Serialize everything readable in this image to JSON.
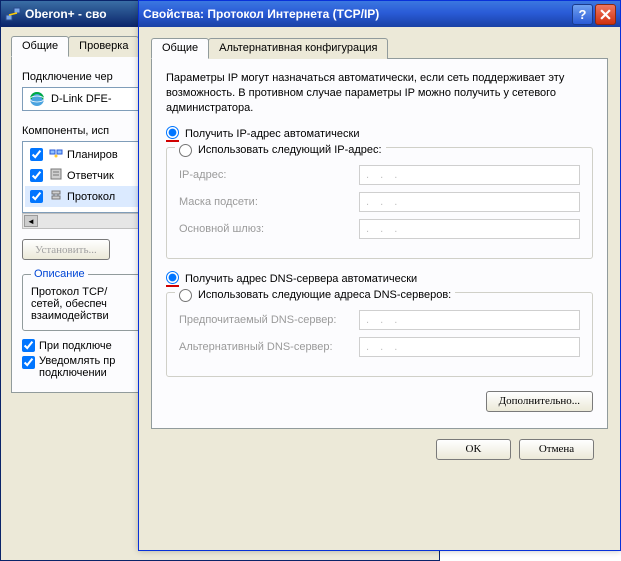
{
  "back": {
    "title": "Oberon+ - сво",
    "tabs": [
      "Общие",
      "Проверка"
    ],
    "connect_via_label": "Подключение чер",
    "adapter": "D-Link DFE-",
    "components_label": "Компоненты, исп",
    "components": [
      {
        "checked": true,
        "label": "Планиров"
      },
      {
        "checked": true,
        "label": "Ответчик"
      },
      {
        "checked": true,
        "label": "Протокол"
      }
    ],
    "install_btn": "Установить...",
    "desc_legend": "Описание",
    "desc_text": "Протокол TCP/\nсетей, обеспеч\nвзаимодействи",
    "cb_connect": "При подключе",
    "cb_notify": "Уведомлять пр\nподключении"
  },
  "front": {
    "title": "Свойства: Протокол Интернета (TCP/IP)",
    "tabs": [
      "Общие",
      "Альтернативная конфигурация"
    ],
    "info": "Параметры IP могут назначаться автоматически, если сеть поддерживает эту возможность. В противном случае параметры IP можно получить у сетевого администратора.",
    "ip_auto": "Получить IP-адрес автоматически",
    "ip_manual": "Использовать следующий IP-адрес:",
    "ip_addr": "IP-адрес:",
    "mask": "Маска подсети:",
    "gateway": "Основной шлюз:",
    "dns_auto": "Получить адрес DNS-сервера автоматически",
    "dns_manual": "Использовать следующие адреса DNS-серверов:",
    "dns_pref": "Предпочитаемый DNS-сервер:",
    "dns_alt": "Альтернативный DNS-сервер:",
    "advanced": "Дополнительно...",
    "ok": "OK",
    "cancel": "Отмена",
    "ip_dots": ".   .   ."
  }
}
